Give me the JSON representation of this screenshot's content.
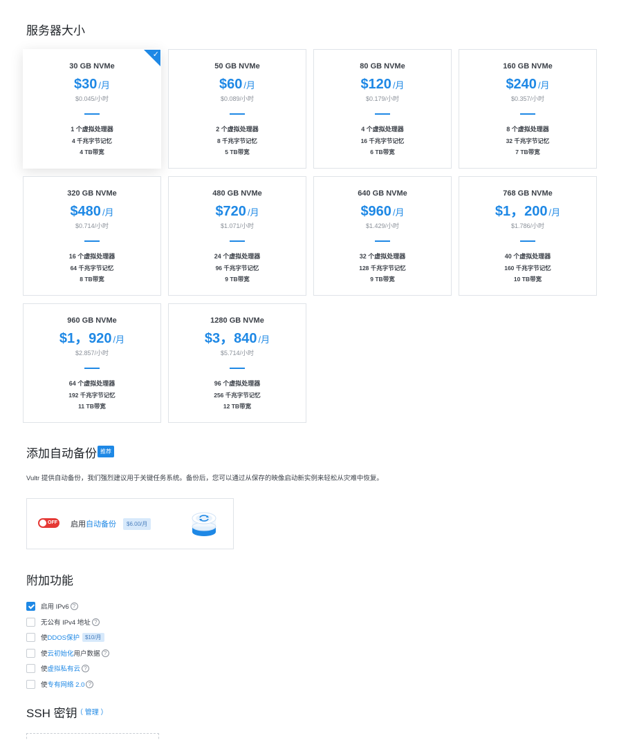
{
  "server_size": {
    "title": "服务器大小",
    "plans": [
      {
        "storage": "30 GB NVMe",
        "price": "$30",
        "unit": "/月",
        "hourly": "$0.045/小时",
        "cpu": "1 个虚拟处理器",
        "ram": "4 千兆字节记忆",
        "bw": "4 TB带宽",
        "selected": true
      },
      {
        "storage": "50 GB NVMe",
        "price": "$60",
        "unit": "/月",
        "hourly": "$0.089/小时",
        "cpu": "2 个虚拟处理器",
        "ram": "8 千兆字节记忆",
        "bw": "5 TB带宽",
        "selected": false
      },
      {
        "storage": "80 GB NVMe",
        "price": "$120",
        "unit": "/月",
        "hourly": "$0.179/小时",
        "cpu": "4 个虚拟处理器",
        "ram": "16 千兆字节记忆",
        "bw": "6 TB带宽",
        "selected": false
      },
      {
        "storage": "160 GB NVMe",
        "price": "$240",
        "unit": "/月",
        "hourly": "$0.357/小时",
        "cpu": "8 个虚拟处理器",
        "ram": "32 千兆字节记忆",
        "bw": "7 TB带宽",
        "selected": false
      },
      {
        "storage": "320 GB NVMe",
        "price": "$480",
        "unit": "/月",
        "hourly": "$0.714/小时",
        "cpu": "16 个虚拟处理器",
        "ram": "64 千兆字节记忆",
        "bw": "8 TB带宽",
        "selected": false
      },
      {
        "storage": "480 GB NVMe",
        "price": "$720",
        "unit": "/月",
        "hourly": "$1.071/小时",
        "cpu": "24 个虚拟处理器",
        "ram": "96 千兆字节记忆",
        "bw": "9 TB带宽",
        "selected": false
      },
      {
        "storage": "640 GB NVMe",
        "price": "$960",
        "unit": "/月",
        "hourly": "$1.429/小时",
        "cpu": "32 个虚拟处理器",
        "ram": "128 千兆字节记忆",
        "bw": "9 TB带宽",
        "selected": false
      },
      {
        "storage": "768 GB NVMe",
        "price": "$1，200",
        "unit": "/月",
        "hourly": "$1.786/小时",
        "cpu": "40 个虚拟处理器",
        "ram": "160 千兆字节记忆",
        "bw": "10 TB带宽",
        "selected": false
      },
      {
        "storage": "960 GB NVMe",
        "price": "$1，920",
        "unit": "/月",
        "hourly": "$2.857/小时",
        "cpu": "64 个虚拟处理器",
        "ram": "192 千兆字节记忆",
        "bw": "11 TB带宽",
        "selected": false
      },
      {
        "storage": "1280 GB NVMe",
        "price": "$3，840",
        "unit": "/月",
        "hourly": "$5.714/小时",
        "cpu": "96 个虚拟处理器",
        "ram": "256 千兆字节记忆",
        "bw": "12 TB带宽",
        "selected": false
      }
    ]
  },
  "backup": {
    "title": "添加自动备份",
    "badge": "推荐",
    "description": "Vultr 提供自动备份，我们强烈建议用于关键任务系统。备份后，您可以通过从保存的映像启动新实例来轻松从灾难中恢复。",
    "toggle_text": "OFF",
    "toggle_state": "off",
    "label_prefix": "启用",
    "label_link": "自动备份",
    "price_tag": "$6.00/月",
    "icon": "disk-backup-icon"
  },
  "features": {
    "title": "附加功能",
    "items": [
      {
        "pre": "启用 IPv6",
        "link": "",
        "post": "",
        "checked": true,
        "help": true,
        "tag": ""
      },
      {
        "pre": "无公有 IPv4 地址",
        "link": "",
        "post": "",
        "checked": false,
        "help": true,
        "tag": ""
      },
      {
        "pre": "使",
        "link": "DDOS保护",
        "post": "",
        "checked": false,
        "help": false,
        "tag": "$10/月"
      },
      {
        "pre": "使",
        "link": "云初始化",
        "post": "用户数据",
        "checked": false,
        "help": true,
        "tag": ""
      },
      {
        "pre": "使",
        "link": "虚拟私有云",
        "post": "",
        "checked": false,
        "help": true,
        "tag": ""
      },
      {
        "pre": "使",
        "link": "专有网络 2.0",
        "post": "",
        "checked": false,
        "help": true,
        "tag": ""
      }
    ]
  },
  "ssh": {
    "title": "SSH 密钥",
    "manage": "（ 管理 ）"
  },
  "colors": {
    "accent": "#1e88e5",
    "toggle_off": "#e53935",
    "tag_bg": "#d7e9fb"
  }
}
